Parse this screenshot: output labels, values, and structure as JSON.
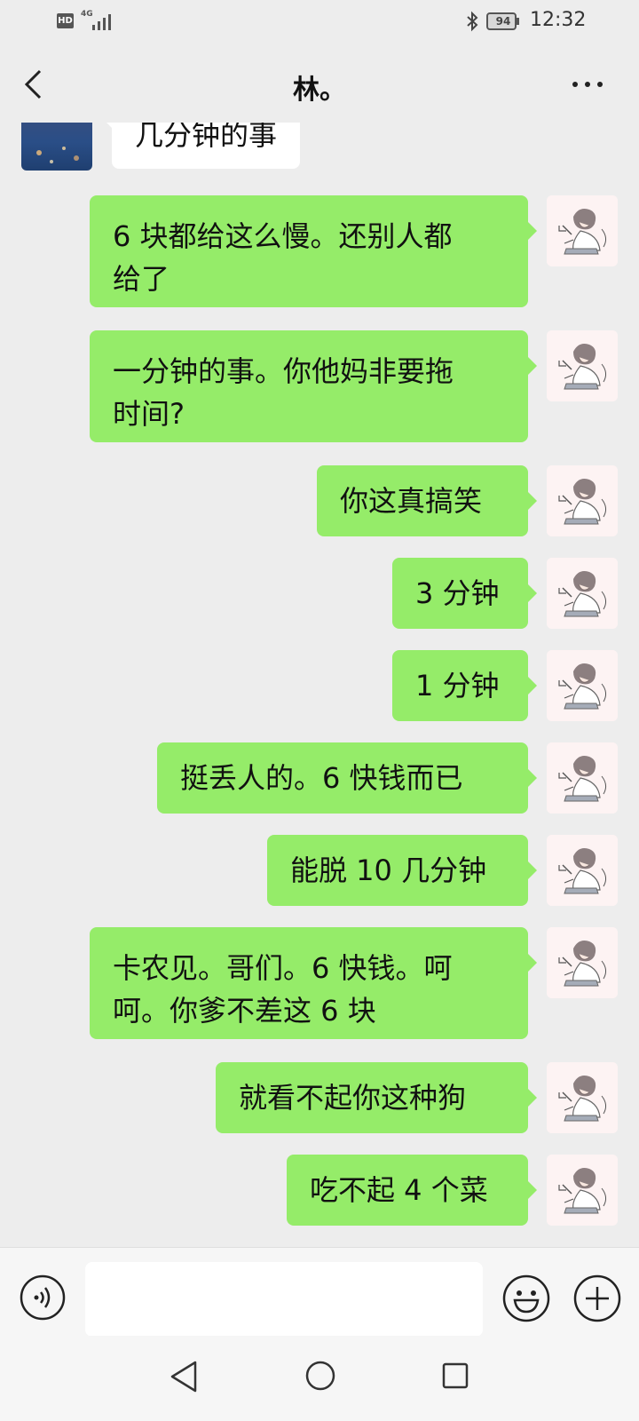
{
  "status_bar": {
    "hd_label": "HD",
    "network_label": "4G",
    "battery_level": "94",
    "time": "12:32",
    "icons": [
      "signal-icon",
      "bluetooth-icon",
      "battery-icon"
    ]
  },
  "header": {
    "title": "林。",
    "back_icon": "chevron-left-icon",
    "more_icon": "more-dots-icon"
  },
  "messages": [
    {
      "sender": "other",
      "text": "几分钟的事"
    },
    {
      "sender": "me",
      "lines": [
        "6 块都给这么慢。还别人都",
        "给了"
      ]
    },
    {
      "sender": "me",
      "lines": [
        "一分钟的事。你他妈非要拖",
        "时间?"
      ]
    },
    {
      "sender": "me",
      "lines": [
        "你这真搞笑"
      ]
    },
    {
      "sender": "me",
      "lines": [
        "3 分钟"
      ]
    },
    {
      "sender": "me",
      "lines": [
        "1 分钟"
      ]
    },
    {
      "sender": "me",
      "lines": [
        "挺丢人的。6 快钱而已"
      ]
    },
    {
      "sender": "me",
      "lines": [
        "能脱 10 几分钟"
      ]
    },
    {
      "sender": "me",
      "lines": [
        "卡农见。哥们。6 快钱。呵",
        "呵。你爹不差这 6 块"
      ]
    },
    {
      "sender": "me",
      "lines": [
        "就看不起你这种狗"
      ]
    },
    {
      "sender": "me",
      "lines": [
        "吃不起 4 个菜"
      ]
    }
  ],
  "input_bar": {
    "voice_icon": "voice-icon",
    "emoji_icon": "emoji-icon",
    "plus_icon": "plus-icon",
    "input_value": ""
  },
  "nav_bar": {
    "icons": [
      "nav-back-icon",
      "nav-home-icon",
      "nav-recent-icon"
    ]
  },
  "colors": {
    "background": "#ededed",
    "bubble_me": "#95ec69",
    "bubble_other": "#ffffff"
  }
}
